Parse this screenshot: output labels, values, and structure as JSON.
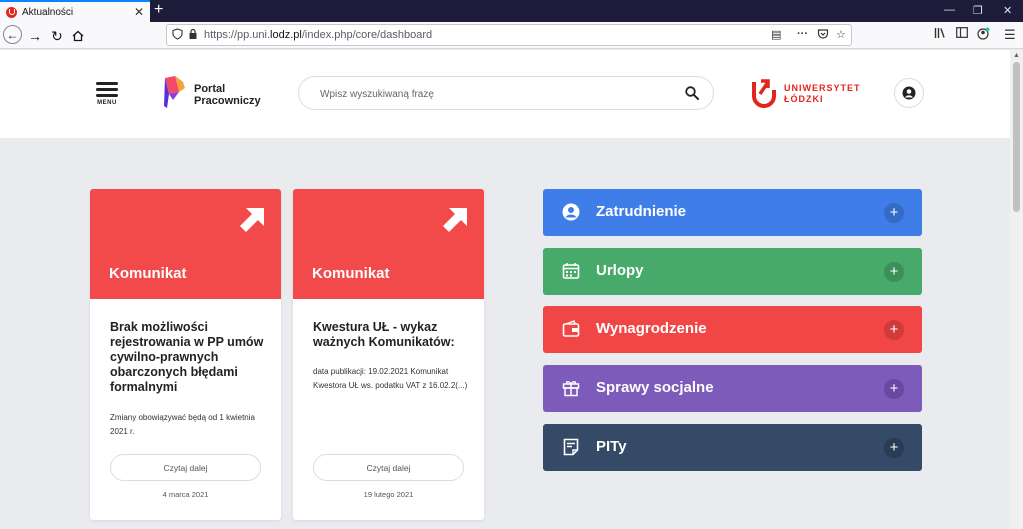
{
  "browser": {
    "tab_title": "Aktualności",
    "url_prefix": "https://pp.uni.",
    "url_domain": "lodz.pl",
    "url_path": "/index.php/core/dashboard"
  },
  "header": {
    "menu_label": "MENU",
    "portal_line1": "Portal",
    "portal_line2": "Pracowniczy",
    "search_placeholder": "Wpisz wyszukiwaną frazę",
    "university_line1": "UNIWERSYTET",
    "university_line2": "ŁÓDZKI"
  },
  "cards": [
    {
      "type": "Komunikat",
      "title": "Brak możliwości rejestrowania w PP umów cywilno-prawnych obarczonych błędami formalnymi",
      "excerpt": "Zmiany obowiązywać będą od 1 kwietnia 2021 r.",
      "button": "Czytaj dalej",
      "date": "4 marca 2021"
    },
    {
      "type": "Komunikat",
      "title": "Kwestura UŁ - wykaz ważnych Komunikatów:",
      "excerpt": "data publikacji: 19.02.2021 Komunikat Kwestora UŁ ws. podatku VAT z 16.02.2(...)",
      "button": "Czytaj dalej",
      "date": "19 lutego 2021"
    }
  ],
  "tiles": [
    {
      "label": "Zatrudnienie",
      "icon": "user-circle-icon",
      "color": "#3f7ee8",
      "plus_color": "#356bc5"
    },
    {
      "label": "Urlopy",
      "icon": "calendar-icon",
      "color": "#47a96a",
      "plus_color": "#3b8f59"
    },
    {
      "label": "Wynagrodzenie",
      "icon": "wallet-icon",
      "color": "#f14646",
      "plus_color": "#cf3a3a"
    },
    {
      "label": "Sprawy socjalne",
      "icon": "gift-icon",
      "color": "#7c5bbb",
      "plus_color": "#68499f"
    },
    {
      "label": "PITy",
      "icon": "document-icon",
      "color": "#344a67",
      "plus_color": "#2a3c54"
    }
  ]
}
